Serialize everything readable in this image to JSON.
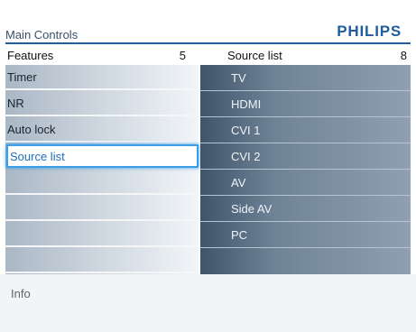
{
  "header": {
    "title": "Main Controls",
    "brand": "PHILIPS"
  },
  "left_panel": {
    "title": "Features",
    "count": "5",
    "items": [
      {
        "label": "Timer"
      },
      {
        "label": "NR"
      },
      {
        "label": "Auto lock"
      },
      {
        "label": "Source list",
        "selected": true
      },
      {
        "label": ""
      },
      {
        "label": ""
      },
      {
        "label": ""
      },
      {
        "label": ""
      }
    ]
  },
  "right_panel": {
    "title": "Source list",
    "count": "8",
    "items": [
      {
        "label": "TV"
      },
      {
        "label": "HDMI"
      },
      {
        "label": "CVI 1"
      },
      {
        "label": "CVI 2"
      },
      {
        "label": "AV"
      },
      {
        "label": "Side AV"
      },
      {
        "label": "PC"
      },
      {
        "label": ""
      }
    ]
  },
  "info": {
    "label": "Info"
  },
  "colors": {
    "accent": "#1f5d9e",
    "selection_border": "#3c9ee6",
    "selected_text": "#1f6fbf"
  }
}
